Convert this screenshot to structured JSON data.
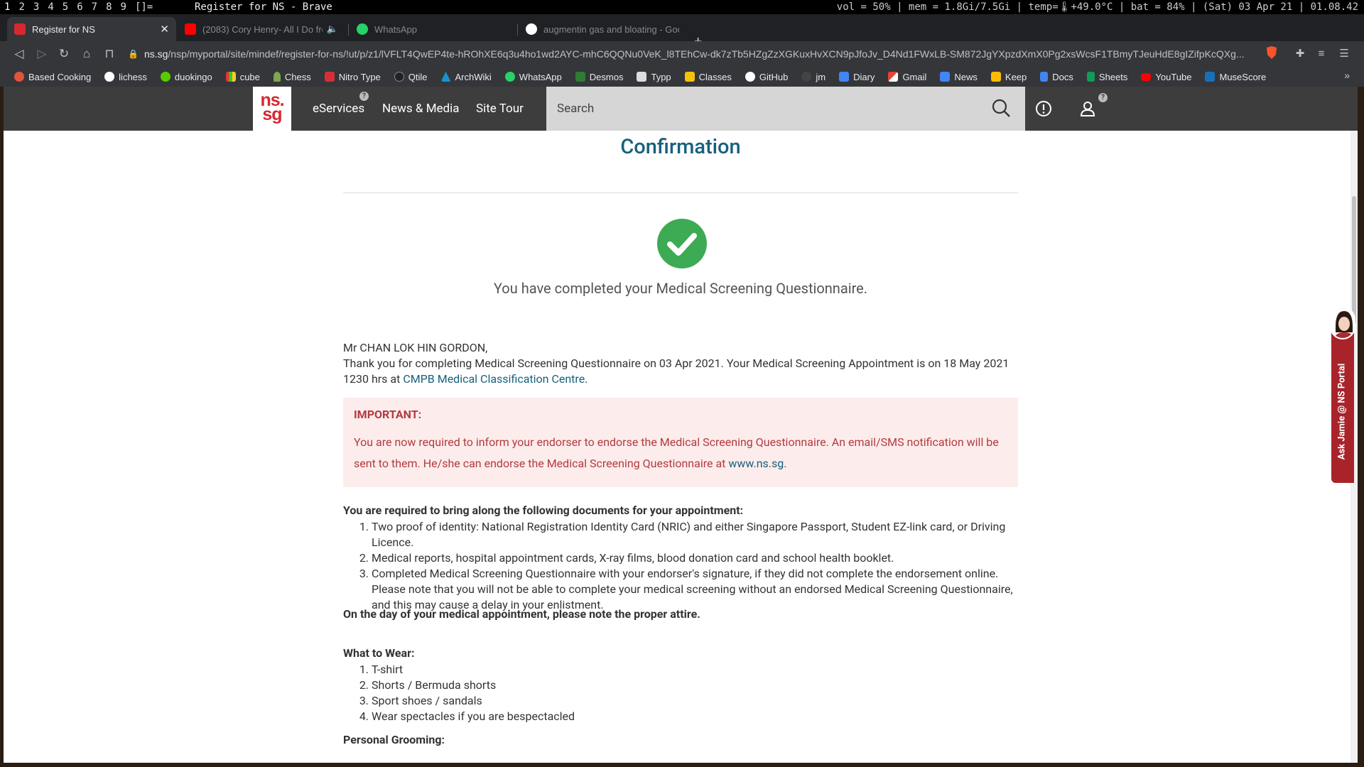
{
  "statusbar": {
    "workspaces": [
      "1",
      "2",
      "3",
      "4",
      "5",
      "6",
      "7",
      "8",
      "9"
    ],
    "layout": "[]=",
    "window_title": "Register for NS - Brave",
    "system": "vol = 50% | mem = 1.8Gi/7.5Gi | temp=🌡+49.0°C | bat = 84% | (Sat) 03 Apr 21 | 01.08.42"
  },
  "tabs": [
    {
      "title": "Register for NS",
      "favicon_color": "#d7282f",
      "active": true
    },
    {
      "title": "(2083) Cory Henry- All I Do from",
      "favicon_color": "#ff0000",
      "active": false
    },
    {
      "title": "WhatsApp",
      "favicon_color": "#25d366",
      "active": false
    },
    {
      "title": "augmentin gas and bloating - Goo",
      "favicon_color": "#ffffff",
      "active": false
    }
  ],
  "address_bar": {
    "host": "ns.sg",
    "path": "/nsp/myportal/site/mindef/register-for-ns/!ut/p/z1/lVFLT4QwEP4te-hROhXE6q3u4ho1wd2AYC-mhC6QQNu0VeK_l8TEhCw-dk7zTb5HZgZzXGKuxHvXCN9pJfoJv_D4Nd1FWxLB-SM872JgYXpzdXmX0Pg2xsWcsF1TBmyTJeuHdE8gIZifpKcQXg..."
  },
  "bookmarks": [
    {
      "label": "Based Cooking",
      "color": "#e0543c"
    },
    {
      "label": "lichess",
      "color": "#ffffff"
    },
    {
      "label": "duokingo",
      "color": "#58cc02"
    },
    {
      "label": "cube",
      "color": "#f2b33d"
    },
    {
      "label": "Chess",
      "color": "#7fa650"
    },
    {
      "label": "Nitro Type",
      "color": "#d62f3a"
    },
    {
      "label": "Qtile",
      "color": "#222222"
    },
    {
      "label": "ArchWiki",
      "color": "#1793d1"
    },
    {
      "label": "WhatsApp",
      "color": "#25d366"
    },
    {
      "label": "Desmos",
      "color": "#2f7d32"
    },
    {
      "label": "Typp",
      "color": "#dddddd"
    },
    {
      "label": "Classes",
      "color": "#f4c20d"
    },
    {
      "label": "GitHub",
      "color": "#ffffff"
    },
    {
      "label": "jm",
      "color": "#444444"
    },
    {
      "label": "Diary",
      "color": "#4285f4"
    },
    {
      "label": "Gmail",
      "color": "#ea4335"
    },
    {
      "label": "News",
      "color": "#4285f4"
    },
    {
      "label": "Keep",
      "color": "#fbbc04"
    },
    {
      "label": "Docs",
      "color": "#4285f4"
    },
    {
      "label": "Sheets",
      "color": "#0f9d58"
    },
    {
      "label": "YouTube",
      "color": "#ff0000"
    },
    {
      "label": "MuseScore",
      "color": "#1a70b8"
    }
  ],
  "site": {
    "logo_top": "ns.",
    "logo_bottom": "sg",
    "nav": [
      "eServices",
      "News & Media",
      "Site Tour"
    ],
    "search_placeholder": "Search"
  },
  "content": {
    "title": "Confirmation",
    "completed": "You have completed your Medical Screening Questionnaire.",
    "greeting": "Mr CHAN LOK HIN GORDON,",
    "thanks": "Thank you for completing Medical Screening Questionnaire on 03 Apr 2021. Your Medical Screening Appointment is on 18 May 2021 1230 hrs at ",
    "centre_link": "CMPB Medical Classification Centre",
    "period": ".",
    "important_head": "IMPORTANT:",
    "important_body": "You are now required to inform your endorser to endorse the Medical Screening Questionnaire. An email/SMS notification will be sent to them. He/she can endorse the Medical Screening Questionnaire at ",
    "important_link": "www.ns.sg",
    "docs_head": "You are required to bring along the following documents for your appointment:",
    "docs": [
      "Two proof of identity: National Registration Identity Card (NRIC) and either Singapore Passport, Student EZ-link card, or Driving Licence.",
      "Medical reports, hospital appointment cards, X-ray films, blood donation card and school health booklet.",
      "Completed Medical Screening Questionnaire with your endorser's signature, if they did not complete the endorsement online. Please note that you will not be able to complete your medical screening without an endorsed Medical Screening Questionnaire, and this may cause a delay in your enlistment."
    ],
    "attire_head": "On the day of your medical appointment, please note the proper attire.",
    "wear_head": "What to Wear:",
    "wear": [
      "T-shirt",
      "Shorts / Bermuda shorts",
      "Sport shoes / sandals",
      "Wear spectacles if you are bespectacled"
    ],
    "grooming_head": "Personal Grooming:"
  },
  "ask_jamie": "Ask Jamie @ NS Portal",
  "colors": {
    "brand_red": "#d7282f",
    "header_bg": "#3d3d3d",
    "title_blue": "#17607d",
    "success_green": "#3daa54"
  }
}
